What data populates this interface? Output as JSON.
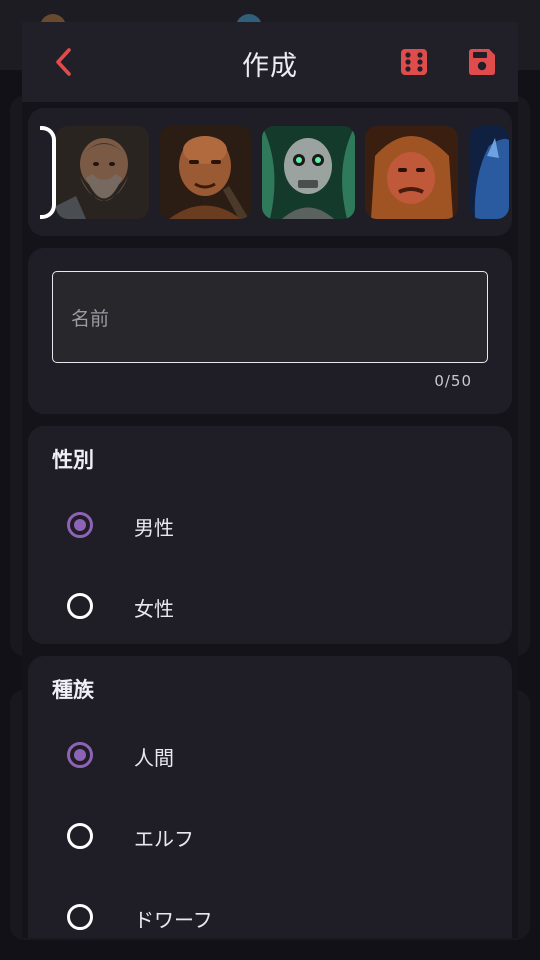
{
  "header": {
    "title": "作成",
    "back_icon": "chevron-left-icon",
    "dice_icon": "dice-icon",
    "save_icon": "floppy-save-icon"
  },
  "colors": {
    "accent_red": "#E04B4B",
    "accent_purple": "#8E63B6",
    "panel": "#1F1D26",
    "background": "#141319"
  },
  "portraits": [
    {
      "name": "bearded-dwarf-portrait"
    },
    {
      "name": "bald-warrior-portrait"
    },
    {
      "name": "undead-skull-portrait"
    },
    {
      "name": "hooded-ogre-portrait"
    },
    {
      "name": "blue-creature-portrait"
    }
  ],
  "name_field": {
    "placeholder": "名前",
    "value": "",
    "counter": "0/50"
  },
  "gender": {
    "title": "性別",
    "options": [
      {
        "label": "男性",
        "selected": true
      },
      {
        "label": "女性",
        "selected": false
      }
    ]
  },
  "race": {
    "title": "種族",
    "options": [
      {
        "label": "人間",
        "selected": true
      },
      {
        "label": "エルフ",
        "selected": false
      },
      {
        "label": "ドワーフ",
        "selected": false
      }
    ]
  }
}
